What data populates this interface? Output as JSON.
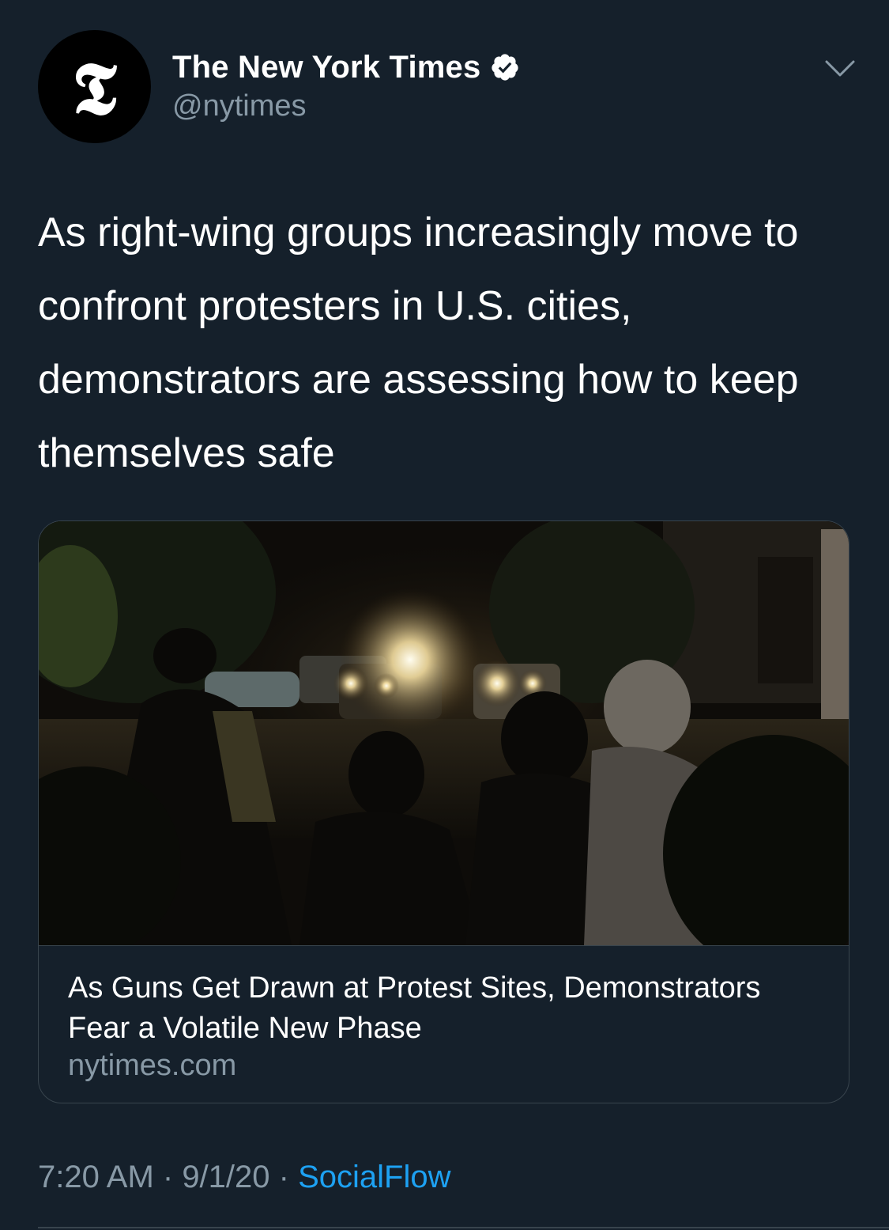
{
  "colors": {
    "background": "#15202b",
    "text_primary": "#ffffff",
    "text_secondary": "#8899a6",
    "accent": "#1da1f2",
    "border": "#38444d"
  },
  "author": {
    "avatar_icon": "nyt-logo-icon",
    "avatar_glyph": "𝕿",
    "display_name": "The New York Times",
    "verified_icon": "verified-badge-icon",
    "handle": "@nytimes"
  },
  "menu": {
    "icon": "chevron-down-icon"
  },
  "tweet": {
    "text": "As right-wing groups increasingly move to confront protesters in U.S. cities, demonstrators are assessing how to keep themselves safe"
  },
  "link_card": {
    "image_icon": "protest-night-photo",
    "title": "As Guns Get Drawn at Protest Sites, Demonstrators Fear a Volatile New Phase",
    "domain": "nytimes.com"
  },
  "meta": {
    "time": "7:20 AM",
    "separator": " · ",
    "date": "9/1/20",
    "source": "SocialFlow"
  }
}
